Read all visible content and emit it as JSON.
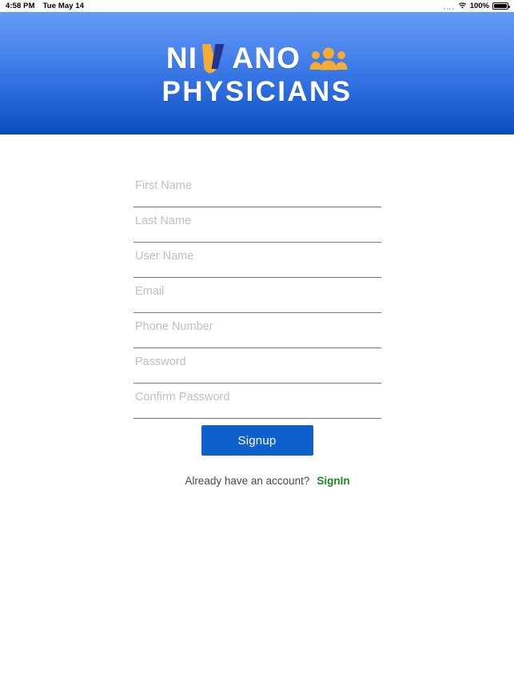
{
  "status_bar": {
    "time": "4:58 PM",
    "date": "Tue May 14",
    "signal_icon": "signal-dots-icon",
    "wifi_icon": "wifi-icon",
    "battery_percent": "100%",
    "battery_icon": "battery-full-icon"
  },
  "header": {
    "brand_part1": "NI",
    "brand_logo_icon": "nivano-v-chevron-icon",
    "brand_part2": "ANO",
    "brand_people_icon": "three-people-icon",
    "brand_line2": "PHYSICIANS",
    "gradient_top_color": "#659AF5",
    "gradient_bottom_color": "#0A4BBD",
    "logo_yellow": "#F5AC30",
    "logo_navy": "#22368C"
  },
  "form": {
    "fields": [
      {
        "name": "first-name",
        "placeholder": "First Name",
        "value": ""
      },
      {
        "name": "last-name",
        "placeholder": "Last Name",
        "value": ""
      },
      {
        "name": "user-name",
        "placeholder": "User Name",
        "value": ""
      },
      {
        "name": "email",
        "placeholder": "Email",
        "value": ""
      },
      {
        "name": "phone-number",
        "placeholder": "Phone Number",
        "value": ""
      },
      {
        "name": "password",
        "placeholder": "Password",
        "value": ""
      },
      {
        "name": "confirm-password",
        "placeholder": "Confirm Password",
        "value": ""
      }
    ],
    "signup_label": "Signup",
    "signup_color": "#0E61CC",
    "already_have_account_text": "Already have an account?",
    "signin_label": "SignIn",
    "signin_color": "#1C8A2A"
  }
}
